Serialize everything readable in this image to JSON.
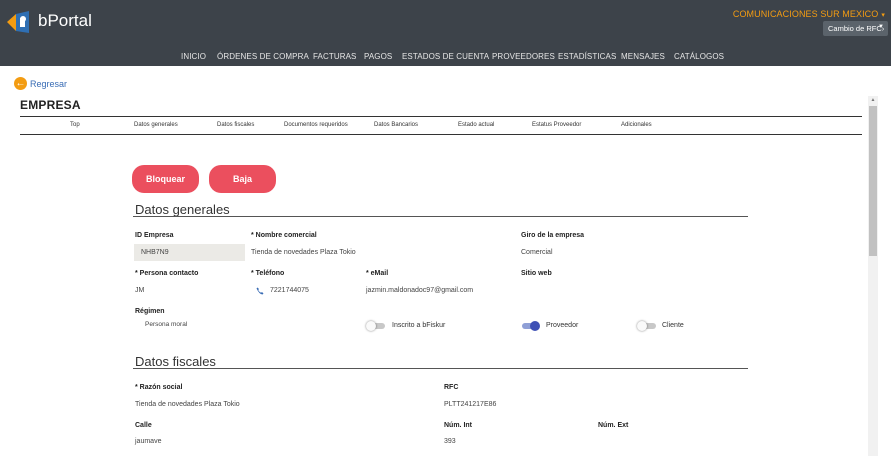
{
  "app": {
    "brand": "bPortal"
  },
  "header": {
    "company": "COMUNICACIONES SUR MEXICO",
    "rfc_button": "Cambio de RFC›"
  },
  "nav": [
    "INICIO",
    "ÓRDENES DE COMPRA",
    "FACTURAS",
    "PAGOS",
    "ESTADOS DE CUENTA",
    "PROVEEDORES",
    "ESTADÍSTICAS",
    "MENSAJES",
    "CATÁLOGOS"
  ],
  "back_label": "Regresar",
  "page_title": "EMPRESA",
  "tabs": [
    "Top",
    "Datos generales",
    "Datos fiscales",
    "Documentos requeridos",
    "Datos Bancarios",
    "Estado actual",
    "Estatus Proveedor",
    "Adicionales"
  ],
  "actions": {
    "block": "Bloquear",
    "remove": "Baja"
  },
  "general": {
    "title": "Datos generales",
    "id_label": "ID Empresa",
    "id_value": "NHB7N9",
    "trade_name_label": "* Nombre comercial",
    "trade_name_value": "Tienda de novedades Plaza Tokio",
    "business_label": "Giro de la empresa",
    "business_value": "Comercial",
    "contact_label": "* Persona contacto",
    "contact_value": "JM",
    "phone_label": "* Teléfono",
    "phone_value": "7221744075",
    "email_label": "* eMail",
    "email_value": "jazmin.maldonadoc97@gmail.com",
    "website_label": "Sitio web",
    "regime_label": "Régimen",
    "regime_value": "Persona moral",
    "toggles": {
      "bfiskur": {
        "label": "Inscrito a bFiskur",
        "on": false
      },
      "supplier": {
        "label": "Proveedor",
        "on": true
      },
      "client": {
        "label": "Cliente",
        "on": false
      }
    }
  },
  "fiscal": {
    "title": "Datos fiscales",
    "legal_name_label": "* Razón social",
    "legal_name_value": "Tienda de novedades Plaza Tokio",
    "rfc_label": "RFC",
    "rfc_value": "PLTT241217E86",
    "street_label": "Calle",
    "street_value": "jaumave",
    "int_label": "Núm. Int",
    "int_value": "393",
    "ext_label": "Núm. Ext"
  },
  "colors": {
    "header_bg": "#3d434a",
    "accent_orange": "#f39c12",
    "action_red": "#eb4f5e",
    "toggle_on": "#3f51b5",
    "link_blue": "#3a6db5"
  }
}
